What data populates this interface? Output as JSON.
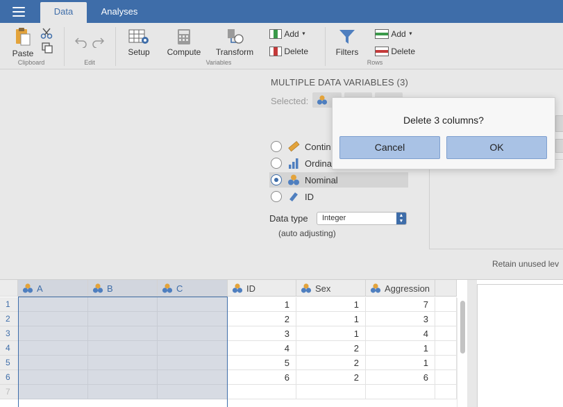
{
  "tabs": [
    {
      "label": "Data",
      "active": true
    },
    {
      "label": "Analyses",
      "active": false
    }
  ],
  "ribbon": {
    "paste": "Paste",
    "clipboard_group": "Clipboard",
    "edit_group": "Edit",
    "setup": "Setup",
    "compute": "Compute",
    "transform": "Transform",
    "variables_group": "Variables",
    "var_add": "Add",
    "var_delete": "Delete",
    "filters": "Filters",
    "row_add": "Add",
    "row_delete": "Delete",
    "rows_group": "Rows"
  },
  "setup_panel": {
    "title": "MULTIPLE DATA VARIABLES (3)",
    "selected_label": "Selected:",
    "measure_types": [
      {
        "label": "Contin",
        "icon": "ruler-icon",
        "checked": false
      },
      {
        "label": "Ordina",
        "icon": "bar-chart-icon",
        "checked": false
      },
      {
        "label": "Nominal",
        "icon": "nominal-circles-icon",
        "checked": true
      },
      {
        "label": "ID",
        "icon": "tag-icon",
        "checked": false
      }
    ],
    "data_type_label": "Data type",
    "data_type_value": "Integer",
    "auto_adjusting": "(auto adjusting)",
    "retain_unused": "Retain unused lev"
  },
  "dialog": {
    "message": "Delete 3 columns?",
    "cancel": "Cancel",
    "ok": "OK"
  },
  "spreadsheet": {
    "columns": [
      {
        "name": "A",
        "selected": true
      },
      {
        "name": "B",
        "selected": true
      },
      {
        "name": "C",
        "selected": true
      },
      {
        "name": "ID",
        "selected": false
      },
      {
        "name": "Sex",
        "selected": false
      },
      {
        "name": "Aggression",
        "selected": false
      }
    ],
    "row_numbers": [
      "1",
      "2",
      "3",
      "4",
      "5",
      "6",
      "7"
    ],
    "rows": [
      [
        "",
        "",
        "",
        "1",
        "1",
        "7"
      ],
      [
        "",
        "",
        "",
        "2",
        "1",
        "3"
      ],
      [
        "",
        "",
        "",
        "3",
        "1",
        "4"
      ],
      [
        "",
        "",
        "",
        "4",
        "2",
        "1"
      ],
      [
        "",
        "",
        "",
        "5",
        "2",
        "1"
      ],
      [
        "",
        "",
        "",
        "6",
        "2",
        "6"
      ],
      [
        "",
        "",
        "",
        "",
        "",
        ""
      ]
    ]
  },
  "colors": {
    "accent": "#3e6da9",
    "dialog_button": "#a9c2e5",
    "selection": "#d7dbe3"
  }
}
